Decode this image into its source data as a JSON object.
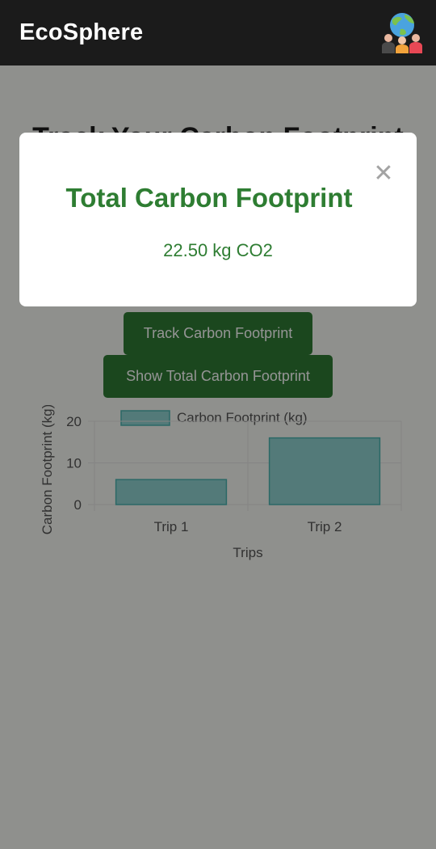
{
  "app": {
    "title": "EcoSphere",
    "logo_icon": "community-globe-icon"
  },
  "page": {
    "heading": "Track Your Carbon Footprint"
  },
  "buttons": {
    "track": "Track Carbon Footprint",
    "show_total": "Show Total Carbon Footprint"
  },
  "modal": {
    "title": "Total Carbon Footprint",
    "value": "22.50 kg CO2",
    "close_icon": "close-icon",
    "close_symbol": "✕"
  },
  "colors": {
    "app_bar": "#1b1b1b",
    "primary_green": "#2e7d32",
    "bar_fill": "#8fd3d1",
    "bar_stroke": "#4bb3b0"
  },
  "chart_data": {
    "type": "bar",
    "categories": [
      "Trip 1",
      "Trip 2"
    ],
    "series": [
      {
        "name": "Carbon Footprint (kg)",
        "values": [
          6,
          16
        ]
      }
    ],
    "xlabel": "Trips",
    "ylabel": "Carbon Footprint (kg)",
    "ylim": [
      0,
      20
    ],
    "yticks": [
      0,
      10,
      20
    ],
    "grid": true,
    "legend": "top"
  }
}
